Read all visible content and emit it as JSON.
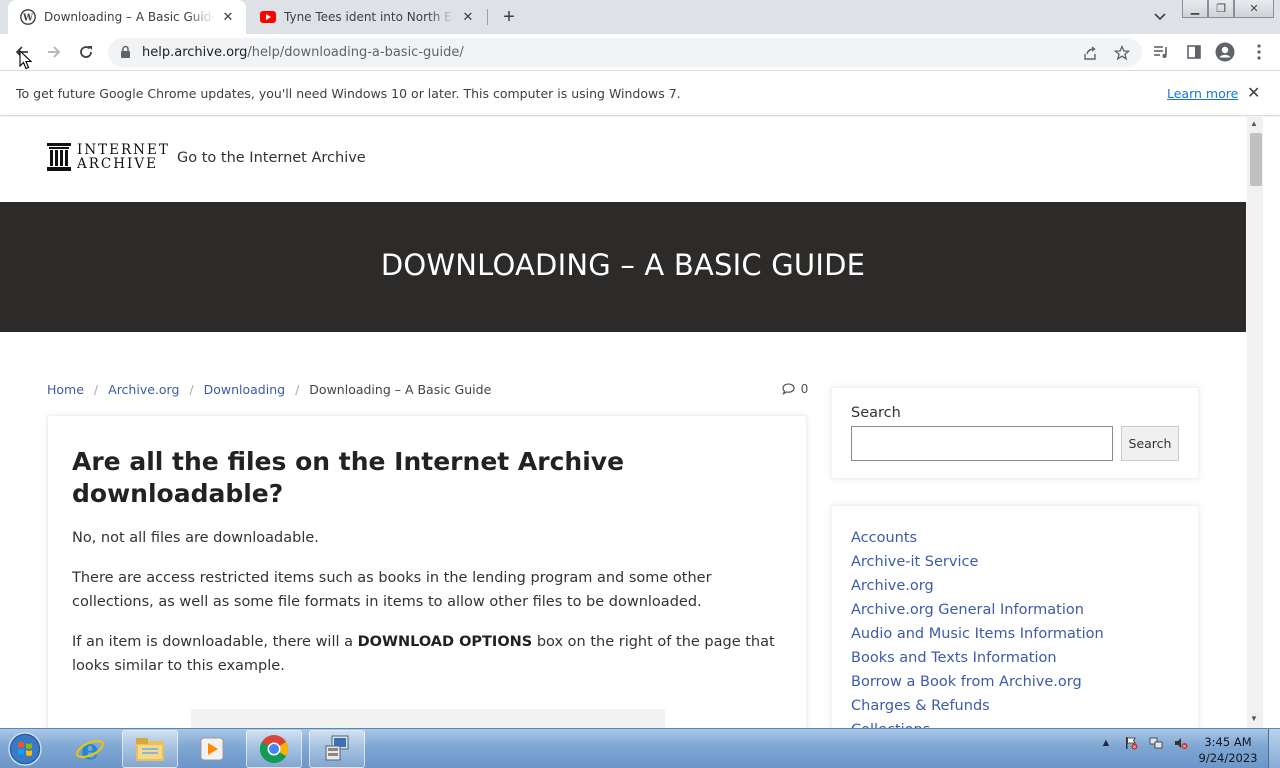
{
  "browser": {
    "tabs": [
      {
        "title": "Downloading – A Basic Guide – Internet Archive Help Center",
        "active": true,
        "favicon": "wordpress-icon"
      },
      {
        "title": "Tyne Tees ident into North East News",
        "active": false,
        "favicon": "youtube-icon"
      }
    ],
    "url_host": "help.archive.org",
    "url_path": "/help/downloading-a-basic-guide/",
    "infobar": {
      "message": "To get future Google Chrome updates, you'll need Windows 10 or later. This computer is using Windows 7.",
      "link": "Learn more"
    }
  },
  "site": {
    "logo_line1": "INTERNET",
    "logo_line2": "ARCHIVE",
    "goto": "Go to the Internet Archive",
    "hero_title": "DOWNLOADING – A BASIC GUIDE",
    "breadcrumbs": [
      "Home",
      "Archive.org",
      "Downloading"
    ],
    "breadcrumb_current": "Downloading – A Basic Guide",
    "comment_count": "0",
    "article": {
      "heading": "Are all the files on the Internet Archive downloadable?",
      "p1": "No, not all files are downloadable.",
      "p2": "There are access restricted items such as books in the lending program and some other collections, as well as some file formats in items to allow other files to be downloaded.",
      "p3_before": "If an item is downloadable, there will a ",
      "p3_bold": "DOWNLOAD OPTIONS",
      "p3_after": " box on the right of the page that looks similar to this example."
    },
    "sidebar": {
      "search_label": "Search",
      "search_value": "",
      "search_button": "Search",
      "categories": [
        "Accounts",
        "Archive-it Service",
        "Archive.org",
        "Archive.org General Information",
        "Audio and Music Items Information",
        "Books and Texts Information",
        "Borrow a Book from Archive.org",
        "Charges & Refunds",
        "Collections"
      ]
    }
  },
  "taskbar": {
    "apps": [
      "windows-start-icon",
      "internet-explorer-icon",
      "file-explorer-icon",
      "media-player-icon",
      "chrome-icon",
      "network-app-icon"
    ],
    "time": "3:45 AM",
    "date": "9/24/2023"
  },
  "colors": {
    "link": "#3c5ba8",
    "hero_bg": "#2d2b2a",
    "chrome_tabstrip": "#dee1e6",
    "chrome_blue": "#1a73e8"
  }
}
